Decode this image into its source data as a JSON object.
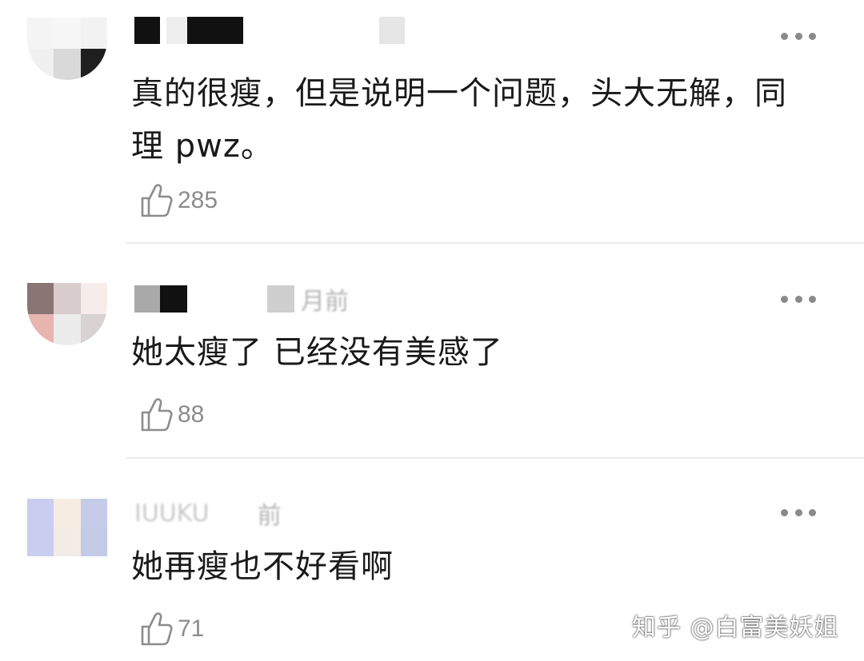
{
  "comments": [
    {
      "time": "",
      "text": "真的很瘦，但是说明一个问题，头大无解，同理 pwz。",
      "likes": "285"
    },
    {
      "time": "月前",
      "text": "她太瘦了 已经没有美感了",
      "likes": "88"
    },
    {
      "username": "IUUKU",
      "time": "前",
      "text": "她再瘦也不好看啊",
      "likes": "71"
    }
  ],
  "watermark": "知乎 @白富美妖姐",
  "icons": {
    "like": "thumbs-up-icon",
    "more": "more-dots-icon"
  },
  "colors": {
    "text": "#1a1a1a",
    "meta": "#8c8c8c",
    "divider": "#ececec"
  }
}
